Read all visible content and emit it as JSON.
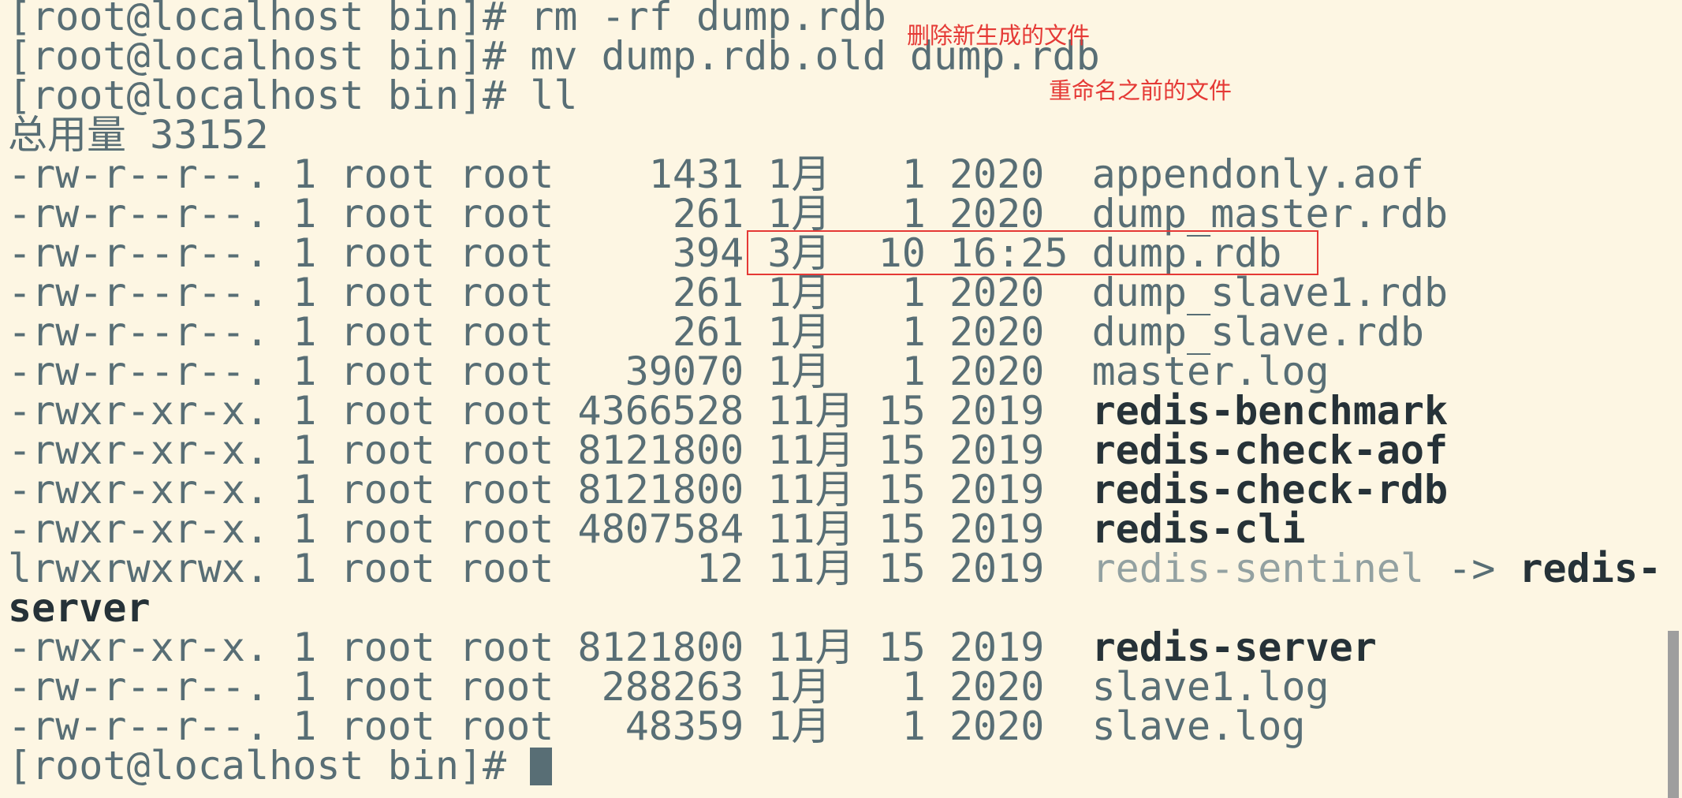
{
  "prompt": "[root@localhost bin]# ",
  "commands": [
    "rm -rf dump.rdb",
    "mv dump.rdb.old dump.rdb",
    "ll"
  ],
  "total_line": "总用量 33152",
  "files": [
    {
      "perm": "-rw-r--r--.",
      "links": "1",
      "owner": "root",
      "group": "root",
      "size": "1431",
      "month": "1月",
      "day": "1",
      "time": "2020",
      "name": "appendonly.aof",
      "style": "normal"
    },
    {
      "perm": "-rw-r--r--.",
      "links": "1",
      "owner": "root",
      "group": "root",
      "size": "261",
      "month": "1月",
      "day": "1",
      "time": "2020",
      "name": "dump_master.rdb",
      "style": "normal"
    },
    {
      "perm": "-rw-r--r--.",
      "links": "1",
      "owner": "root",
      "group": "root",
      "size": "394",
      "month": "3月",
      "day": "10",
      "time": "16:25",
      "name": "dump.rdb",
      "style": "normal"
    },
    {
      "perm": "-rw-r--r--.",
      "links": "1",
      "owner": "root",
      "group": "root",
      "size": "261",
      "month": "1月",
      "day": "1",
      "time": "2020",
      "name": "dump_slave1.rdb",
      "style": "normal"
    },
    {
      "perm": "-rw-r--r--.",
      "links": "1",
      "owner": "root",
      "group": "root",
      "size": "261",
      "month": "1月",
      "day": "1",
      "time": "2020",
      "name": "dump_slave.rdb",
      "style": "normal"
    },
    {
      "perm": "-rw-r--r--.",
      "links": "1",
      "owner": "root",
      "group": "root",
      "size": "39070",
      "month": "1月",
      "day": "1",
      "time": "2020",
      "name": "master.log",
      "style": "normal"
    },
    {
      "perm": "-rwxr-xr-x.",
      "links": "1",
      "owner": "root",
      "group": "root",
      "size": "4366528",
      "month": "11月",
      "day": "15",
      "time": "2019",
      "name": "redis-benchmark",
      "style": "bold"
    },
    {
      "perm": "-rwxr-xr-x.",
      "links": "1",
      "owner": "root",
      "group": "root",
      "size": "8121800",
      "month": "11月",
      "day": "15",
      "time": "2019",
      "name": "redis-check-aof",
      "style": "bold"
    },
    {
      "perm": "-rwxr-xr-x.",
      "links": "1",
      "owner": "root",
      "group": "root",
      "size": "8121800",
      "month": "11月",
      "day": "15",
      "time": "2019",
      "name": "redis-check-rdb",
      "style": "bold"
    },
    {
      "perm": "-rwxr-xr-x.",
      "links": "1",
      "owner": "root",
      "group": "root",
      "size": "4807584",
      "month": "11月",
      "day": "15",
      "time": "2019",
      "name": "redis-cli",
      "style": "bold"
    },
    {
      "perm": "lrwxrwxrwx.",
      "links": "1",
      "owner": "root",
      "group": "root",
      "size": "12",
      "month": "11月",
      "day": "15",
      "time": "2019",
      "name": "redis-sentinel",
      "style": "link",
      "arrow": " -> ",
      "target_part1": "redis-",
      "target_part2": "server"
    },
    {
      "perm": "-rwxr-xr-x.",
      "links": "1",
      "owner": "root",
      "group": "root",
      "size": "8121800",
      "month": "11月",
      "day": "15",
      "time": "2019",
      "name": "redis-server",
      "style": "bold"
    },
    {
      "perm": "-rw-r--r--.",
      "links": "1",
      "owner": "root",
      "group": "root",
      "size": "288263",
      "month": "1月",
      "day": "1",
      "time": "2020",
      "name": "slave1.log",
      "style": "normal"
    },
    {
      "perm": "-rw-r--r--.",
      "links": "1",
      "owner": "root",
      "group": "root",
      "size": "48359",
      "month": "1月",
      "day": "1",
      "time": "2020",
      "name": "slave.log",
      "style": "normal"
    }
  ],
  "annotations": {
    "delete_note": "删除新生成的文件",
    "rename_note": "重命名之前的文件"
  },
  "colors": {
    "background": "#fdf6e3",
    "text": "#586e75",
    "bold_text": "#263238",
    "link_text": "#93a1a1",
    "annotation": "#e53935"
  }
}
